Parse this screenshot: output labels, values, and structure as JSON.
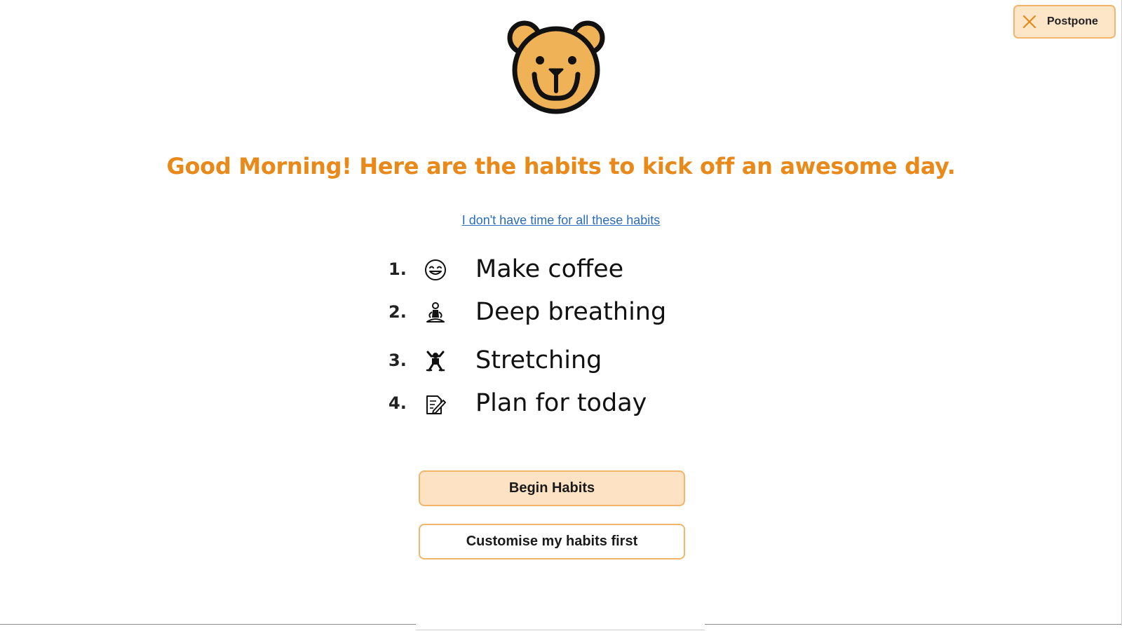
{
  "postpone": {
    "label": "Postpone",
    "icon": "close-icon"
  },
  "logo": {
    "icon": "bear-face-icon",
    "color": "#f0b256"
  },
  "headline": "Good Morning! Here are the habits to kick off an awesome day.",
  "no_time_link": "I don't have time for all these habits",
  "habits": [
    {
      "number": "1.",
      "icon": "smiling-face-icon",
      "label": "Make coffee"
    },
    {
      "number": "2.",
      "icon": "meditating-person-icon",
      "label": "Deep breathing"
    },
    {
      "number": "3.",
      "icon": "stretching-person-icon",
      "label": "Stretching"
    },
    {
      "number": "4.",
      "icon": "memo-pencil-icon",
      "label": "Plan for today"
    }
  ],
  "buttons": {
    "begin_label": "Begin Habits",
    "customise_label": "Customise my habits first"
  },
  "colors": {
    "accent": "#e8891a",
    "button_fill": "#fde2c4",
    "button_border": "#f1b56b",
    "link": "#2b6cb8"
  }
}
